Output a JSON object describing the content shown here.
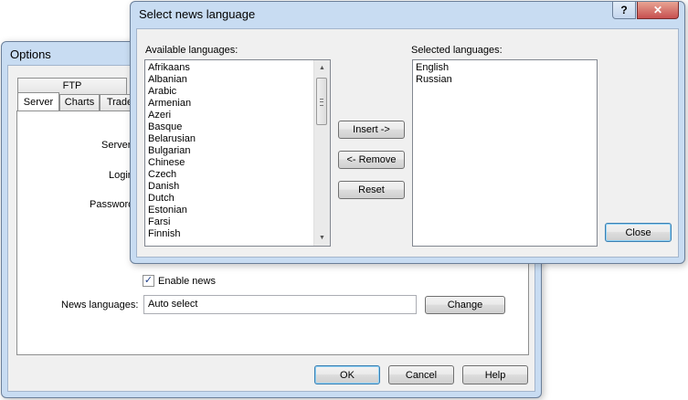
{
  "options_window": {
    "title": "Options",
    "tabs": [
      "Server",
      "Charts",
      "Trade"
    ],
    "upper_tab": "FTP",
    "labels": {
      "server": "Server",
      "login": "Login",
      "password": "Password"
    },
    "enable_news": {
      "label": "Enable news",
      "checked": true,
      "mark": "✓"
    },
    "news_languages": {
      "label": "News languages:",
      "value": "Auto select",
      "change_label": "Change"
    },
    "buttons": {
      "ok": "OK",
      "cancel": "Cancel",
      "help": "Help"
    }
  },
  "language_dialog": {
    "title": "Select news language",
    "help_glyph": "?",
    "close_glyph": "✕",
    "available_label": "Available languages:",
    "available": [
      "Afrikaans",
      "Albanian",
      "Arabic",
      "Armenian",
      "Azeri",
      "Basque",
      "Belarusian",
      "Bulgarian",
      "Chinese",
      "Czech",
      "Danish",
      "Dutch",
      "Estonian",
      "Farsi",
      "Finnish"
    ],
    "selected_label": "Selected languages:",
    "selected": [
      "English",
      "Russian"
    ],
    "insert_label": "Insert ->",
    "remove_label": "<- Remove",
    "reset_label": "Reset",
    "close_label": "Close"
  },
  "colors": {
    "frame": "#c8dcf2",
    "client": "#f0f0f0",
    "close_red": "#c75050"
  }
}
